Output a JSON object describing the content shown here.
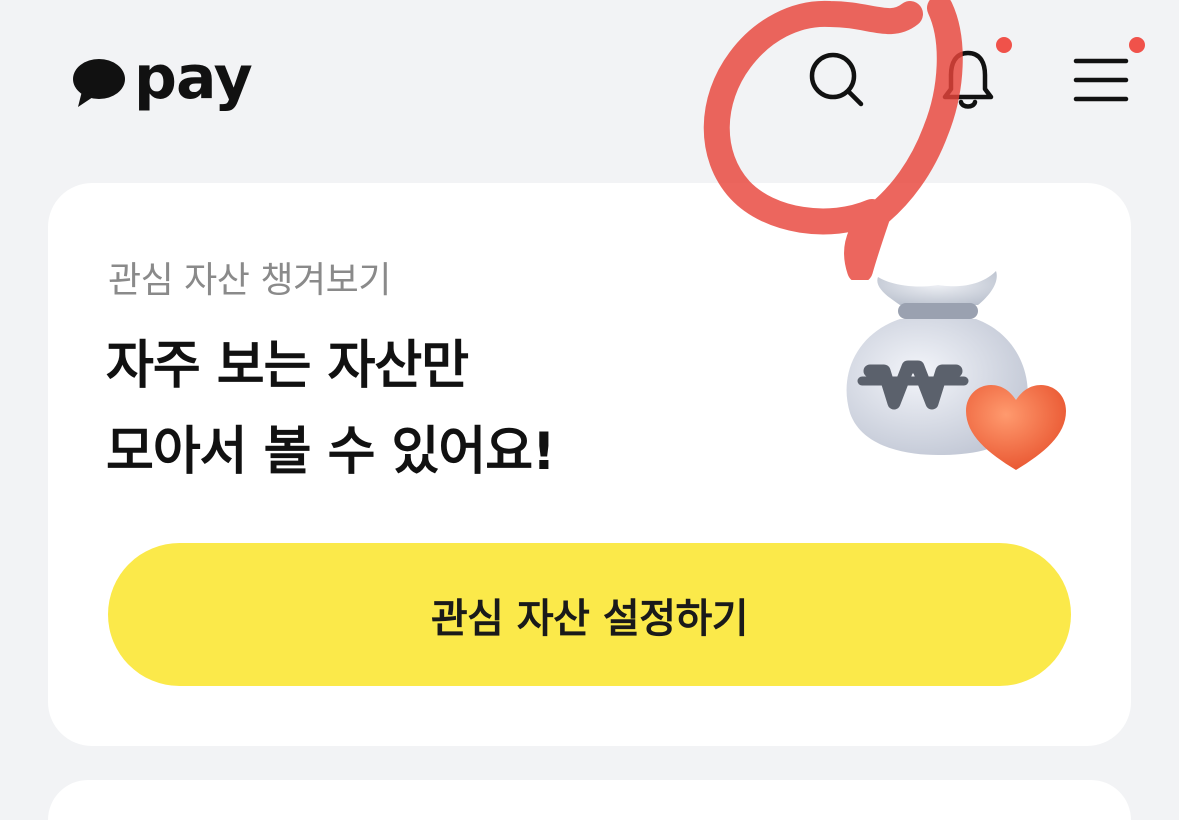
{
  "header": {
    "logo_text": "pay",
    "icons": [
      "search-icon",
      "bell-icon",
      "hamburger-menu-icon"
    ],
    "notification_badge_color": "#f0524a"
  },
  "card": {
    "subtitle": "관심 자산 챙겨보기",
    "title_line1": "자주 보는 자산만",
    "title_line2": "모아서 볼 수 있어요!",
    "illustration": "money-bag-with-heart",
    "button_label": "관심 자산 설정하기"
  },
  "colors": {
    "background": "#f2f3f5",
    "card": "#ffffff",
    "button": "#fbe94a",
    "annotation": "#e8443a"
  }
}
